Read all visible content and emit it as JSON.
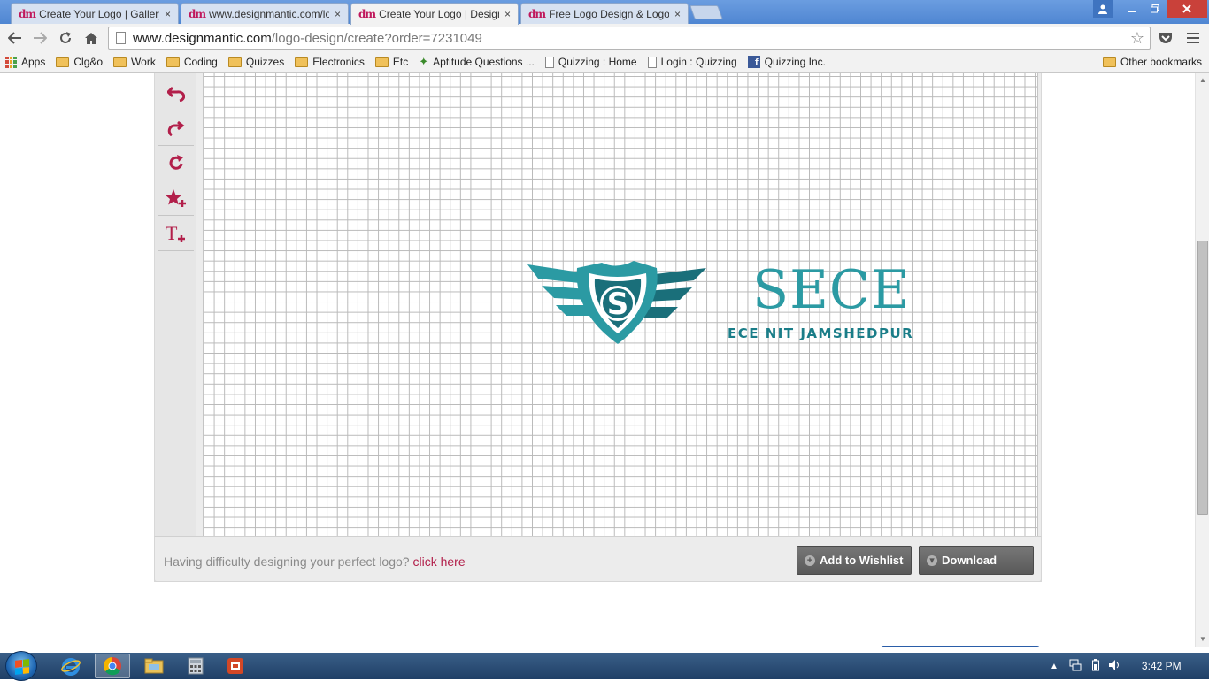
{
  "browser": {
    "tabs": [
      {
        "favicon": "dm",
        "label": "Create Your Logo | Gallery",
        "active": false
      },
      {
        "favicon": "dm",
        "label": "www.designmantic.com/lo",
        "active": false
      },
      {
        "favicon": "dm",
        "label": "Create Your Logo | Design",
        "active": true
      },
      {
        "favicon": "dm",
        "label": "Free Logo Design & Logo",
        "active": false
      }
    ],
    "close_glyph": "×",
    "address": {
      "host": "www.designmantic.com",
      "path": "/logo-design/create?order=7231049"
    },
    "bookmarks": [
      {
        "label": "Apps",
        "icon": "apps-grid-icon"
      },
      {
        "label": "Clg&o",
        "icon": "folder-icon"
      },
      {
        "label": "Work",
        "icon": "folder-icon"
      },
      {
        "label": "Coding",
        "icon": "folder-icon"
      },
      {
        "label": "Quizzes",
        "icon": "folder-icon"
      },
      {
        "label": "Electronics",
        "icon": "folder-icon"
      },
      {
        "label": "Etc",
        "icon": "folder-icon"
      },
      {
        "label": "Aptitude Questions ...",
        "icon": "leaf-icon"
      },
      {
        "label": "Quizzing : Home",
        "icon": "page-icon"
      },
      {
        "label": "Login : Quizzing",
        "icon": "page-icon"
      },
      {
        "label": "Quizzing Inc.",
        "icon": "facebook-icon"
      }
    ],
    "other_bookmarks": "Other bookmarks"
  },
  "editor": {
    "tools": [
      {
        "name": "undo-icon"
      },
      {
        "name": "redo-icon"
      },
      {
        "name": "refresh-icon"
      },
      {
        "name": "add-symbol-icon"
      },
      {
        "name": "add-text-icon"
      }
    ],
    "logo": {
      "title": "SECE",
      "shield_letter": "S",
      "tagline": "ECE NIT JAMSHEDPUR",
      "primary_color": "#2b9aa3",
      "dark_color": "#1a6f7a"
    },
    "help_text": "Having difficulty designing your perfect logo?",
    "help_link": "click here",
    "wishlist_button": "Add to Wishlist",
    "download_button": "Download"
  },
  "taskbar": {
    "time": "3:42 PM",
    "apps": [
      "internet-explorer-icon",
      "chrome-icon",
      "file-explorer-icon",
      "calculator-icon",
      "presentation-icon"
    ]
  },
  "colors": {
    "accent": "#b21f4a",
    "titlebar": "#5a8fd6"
  }
}
